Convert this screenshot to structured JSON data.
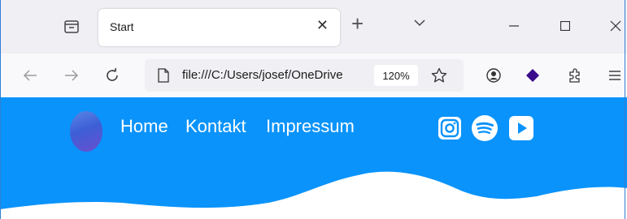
{
  "browser": {
    "tab": {
      "title": "Start",
      "close_glyph": "✕"
    },
    "new_tab_glyph": "+",
    "url": "file:///C:/Users/josef/OneDrive",
    "zoom": "120%"
  },
  "page": {
    "nav": [
      {
        "label": "Home"
      },
      {
        "label": "Kontakt"
      },
      {
        "label": "Impressum"
      }
    ],
    "social": [
      "instagram-icon",
      "spotify-icon",
      "youtube-icon"
    ]
  },
  "colors": {
    "hero_blue": "#0a93fb",
    "frame_blue": "#2f7fd6"
  }
}
